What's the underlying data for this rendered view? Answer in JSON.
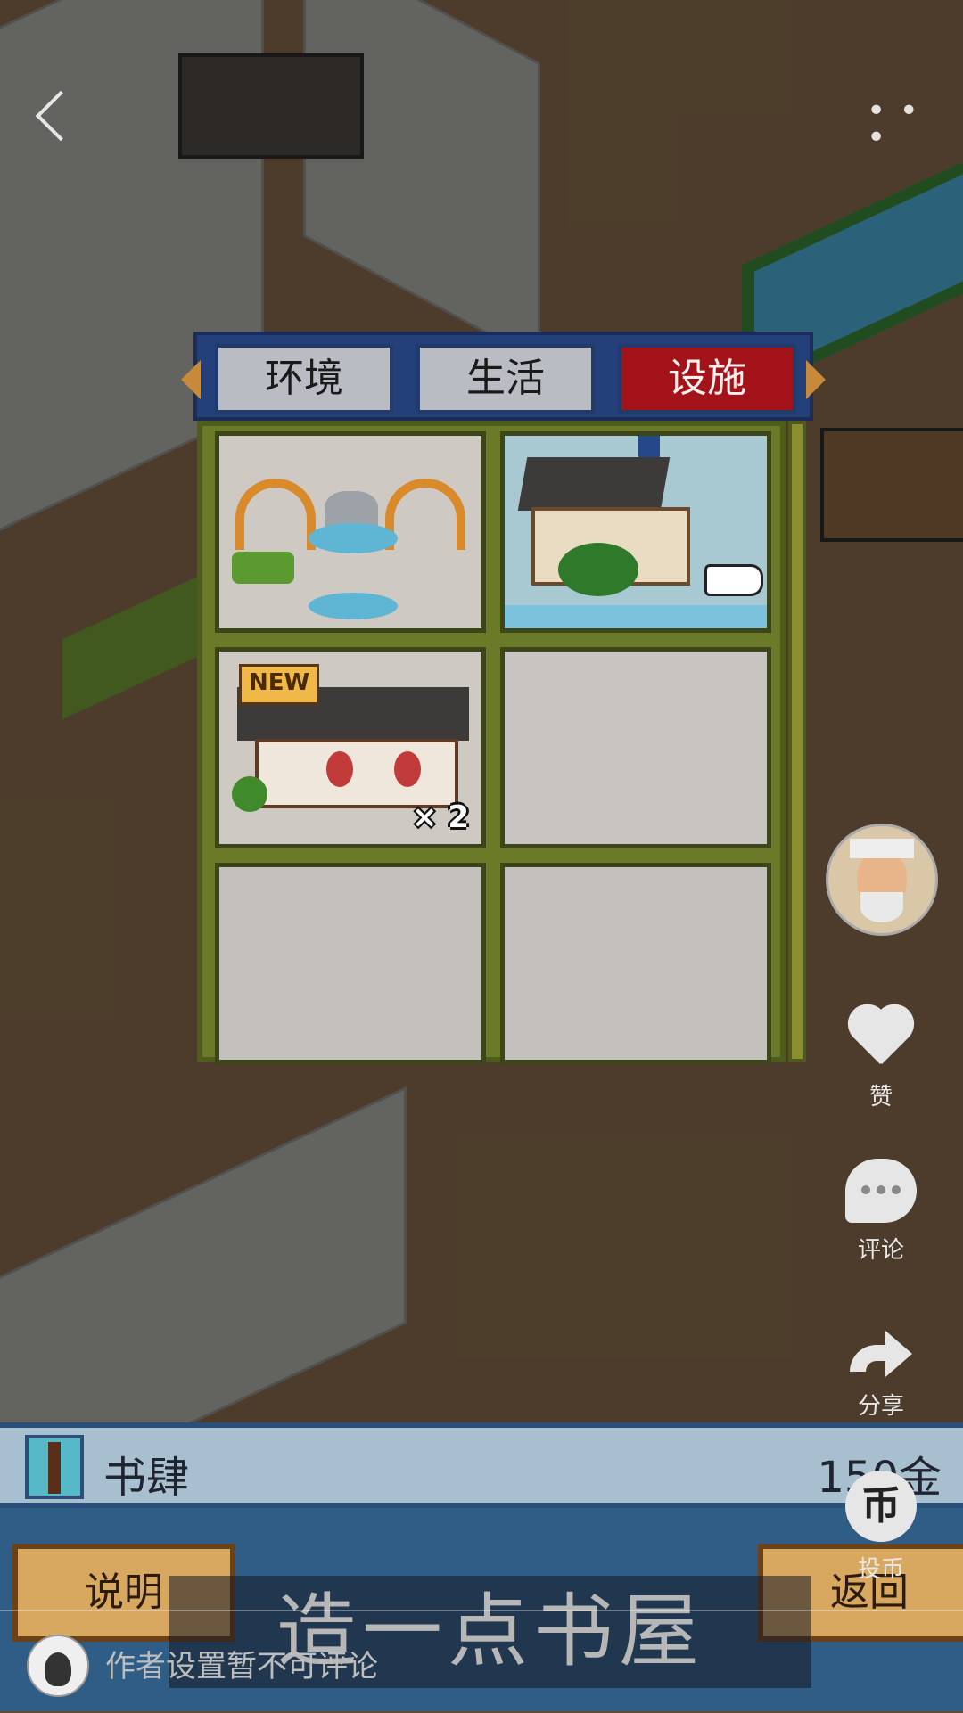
{
  "game": {
    "tabs": [
      "环境",
      "生活",
      "设施"
    ],
    "active_tab": "设施",
    "items": [
      {
        "name": "garden",
        "badge": "",
        "qty": ""
      },
      {
        "name": "school",
        "badge": "",
        "qty": ""
      },
      {
        "name": "library",
        "badge": "NEW",
        "qty": "× 2"
      },
      {
        "name": "empty",
        "badge": "",
        "qty": ""
      },
      {
        "name": "empty",
        "badge": "",
        "qty": ""
      },
      {
        "name": "empty",
        "badge": "",
        "qty": ""
      }
    ],
    "selected_building": "书肆",
    "price": "150金",
    "buttons": {
      "explain": "说明",
      "return": "返回"
    },
    "caption": "造一点书屋"
  },
  "side_actions": {
    "like": "赞",
    "comment": "评论",
    "share": "分享",
    "coin": "投币",
    "coin_glyph": "币"
  },
  "comment_bar": {
    "placeholder": "作者设置暂不可评论"
  },
  "top_bar": {
    "more": "• • •"
  },
  "colors": {
    "active_tab": "#a41319",
    "tab_bar": "#23407a",
    "grid_border": "#4f5c1c"
  }
}
